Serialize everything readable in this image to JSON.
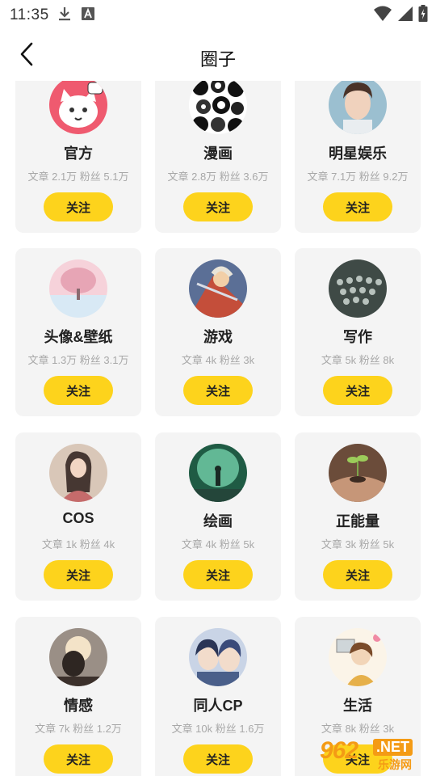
{
  "status_bar": {
    "time": "11:35",
    "icons": [
      "download-icon",
      "font-icon",
      "wifi-icon",
      "signal-icon",
      "battery-icon"
    ]
  },
  "header": {
    "title": "圈子",
    "back_icon": "chevron-left-icon"
  },
  "circles": [
    {
      "name": "官方",
      "stats": "文章 2.1万 粉丝 5.1万",
      "follow": "关注",
      "avatar": "cat-mascot"
    },
    {
      "name": "漫画",
      "stats": "文章 2.8万 粉丝 3.6万",
      "follow": "关注",
      "avatar": "manga-collage"
    },
    {
      "name": "明星娱乐",
      "stats": "文章 7.1万 粉丝 9.2万",
      "follow": "关注",
      "avatar": "celebrity-portrait"
    },
    {
      "name": "头像&壁纸",
      "stats": "文章 1.3万 粉丝 3.1万",
      "follow": "关注",
      "avatar": "pink-tree-snow"
    },
    {
      "name": "游戏",
      "stats": "文章 4k 粉丝 3k",
      "follow": "关注",
      "avatar": "game-character"
    },
    {
      "name": "写作",
      "stats": "文章 5k 粉丝 8k",
      "follow": "关注",
      "avatar": "typewriter"
    },
    {
      "name": "COS",
      "stats": "文章 1k 粉丝 4k",
      "follow": "关注",
      "avatar": "cosplay-girl"
    },
    {
      "name": "绘画",
      "stats": "文章 4k 粉丝 5k",
      "follow": "关注",
      "avatar": "green-forest-painting"
    },
    {
      "name": "正能量",
      "stats": "文章 3k 粉丝 5k",
      "follow": "关注",
      "avatar": "sprout-hands"
    },
    {
      "name": "情感",
      "stats": "文章 7k 粉丝 1.2万",
      "follow": "关注",
      "avatar": "sunset-silhouette"
    },
    {
      "name": "同人CP",
      "stats": "文章 10k 粉丝 1.6万",
      "follow": "关注",
      "avatar": "anime-couple"
    },
    {
      "name": "生活",
      "stats": "文章 8k 粉丝 3k",
      "follow": "关注",
      "avatar": "anime-girl-life"
    }
  ],
  "colors": {
    "accent": "#fdd31c",
    "card_bg": "#f4f4f4",
    "muted_text": "#a8a8a8"
  },
  "watermark": {
    "number": "962",
    "net": ".NET",
    "site": "乐游网"
  }
}
